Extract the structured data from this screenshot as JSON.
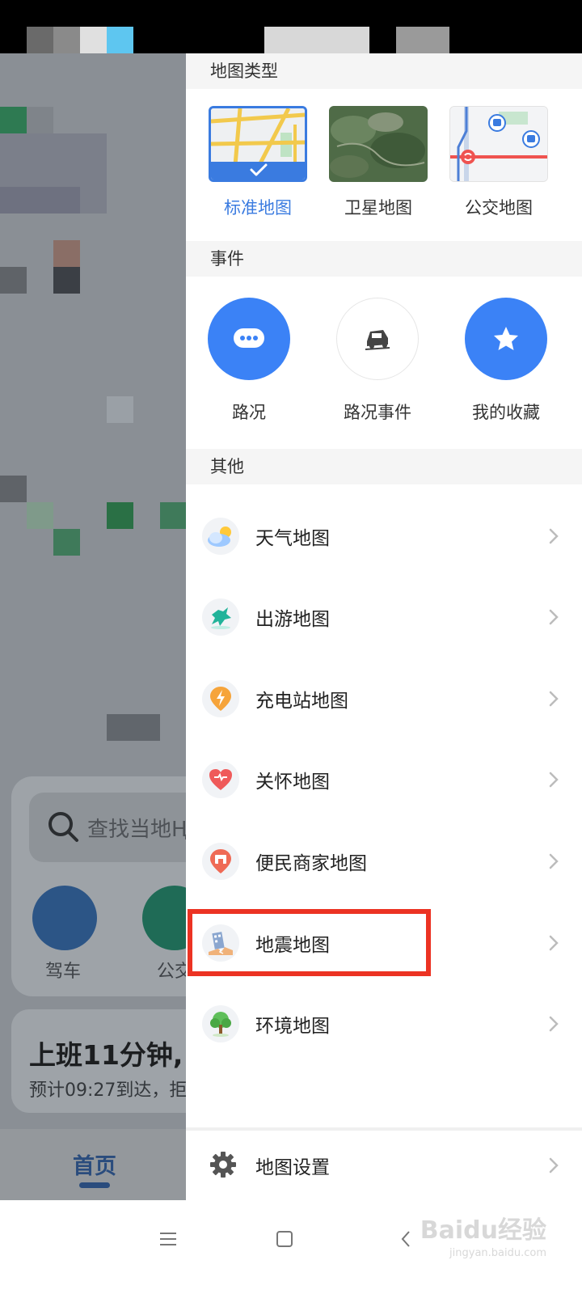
{
  "panel": {
    "map_types_header": "地图类型",
    "map_types": [
      {
        "label": "标准地图",
        "selected": true,
        "icon": "standard-map-thumbnail"
      },
      {
        "label": "卫星地图",
        "selected": false,
        "icon": "satellite-map-thumbnail"
      },
      {
        "label": "公交地图",
        "selected": false,
        "icon": "bus-map-thumbnail"
      }
    ],
    "events_header": "事件",
    "events": [
      {
        "label": "路况",
        "icon": "chat-bubble-icon",
        "color": "#3b82f6"
      },
      {
        "label": "路况事件",
        "icon": "car-accident-icon",
        "color": "#ffffff"
      },
      {
        "label": "我的收藏",
        "icon": "star-icon",
        "color": "#3b82f6"
      }
    ],
    "others_header": "其他",
    "others": [
      {
        "label": "天气地图",
        "icon": "weather-icon"
      },
      {
        "label": "出游地图",
        "icon": "horse-icon"
      },
      {
        "label": "充电站地图",
        "icon": "charging-station-icon"
      },
      {
        "label": "关怀地图",
        "icon": "heart-icon"
      },
      {
        "label": "便民商家地图",
        "icon": "shop-icon"
      },
      {
        "label": "地震地图",
        "icon": "earthquake-icon",
        "highlighted": true
      },
      {
        "label": "环境地图",
        "icon": "tree-icon"
      }
    ],
    "settings_label": "地图设置"
  },
  "background": {
    "search_placeholder": "查找当地Ң",
    "drive_label": "驾车",
    "bus_label": "公交",
    "commute_title": "上班11分钟,",
    "commute_subtitle": "预计09:27到达，拒",
    "home_tab": "首页"
  },
  "watermark": {
    "main": "Baidu经验",
    "sub": "jingyan.baidu.com"
  },
  "colors": {
    "accent": "#3a7be0",
    "highlight_border": "#ec3323"
  }
}
